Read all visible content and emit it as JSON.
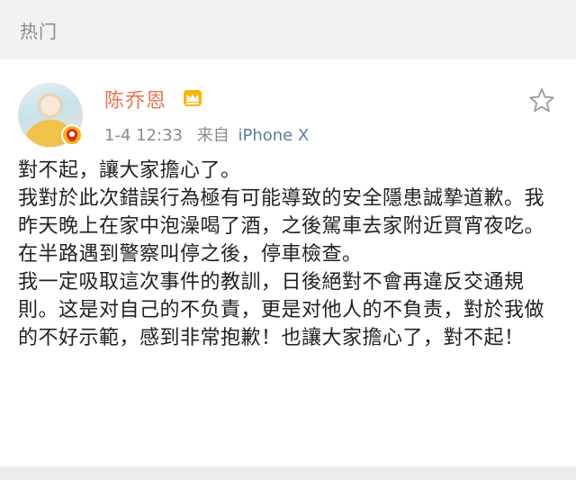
{
  "header": {
    "title": "热门"
  },
  "post": {
    "username": "陈乔恩",
    "time": "1-4 12:33",
    "source_prefix": "来自",
    "device": "iPhone X",
    "paragraphs": [
      "對不起，讓大家擔心了。",
      "我對於此次錯誤行為極有可能導致的安全隱患誠摯道歉。我昨天晚上在家中泡澡喝了酒，之後駕車去家附近買宵夜吃。在半路遇到警察叫停之後，停車檢查。",
      "我一定吸取這次事件的教訓，日後絕對不會再違反交通規則。这是对自己的不负責，更是对他人的不負责，對於我做的不好示範，感到非常抱歉！也讓大家擔心了，對不起！"
    ]
  },
  "icons": {
    "crown": "crown-icon",
    "star": "star-icon",
    "verified": "verified-badge-icon"
  },
  "colors": {
    "username": "#eb7350",
    "device": "#5b7ea7",
    "meta": "#8c8c8c"
  }
}
